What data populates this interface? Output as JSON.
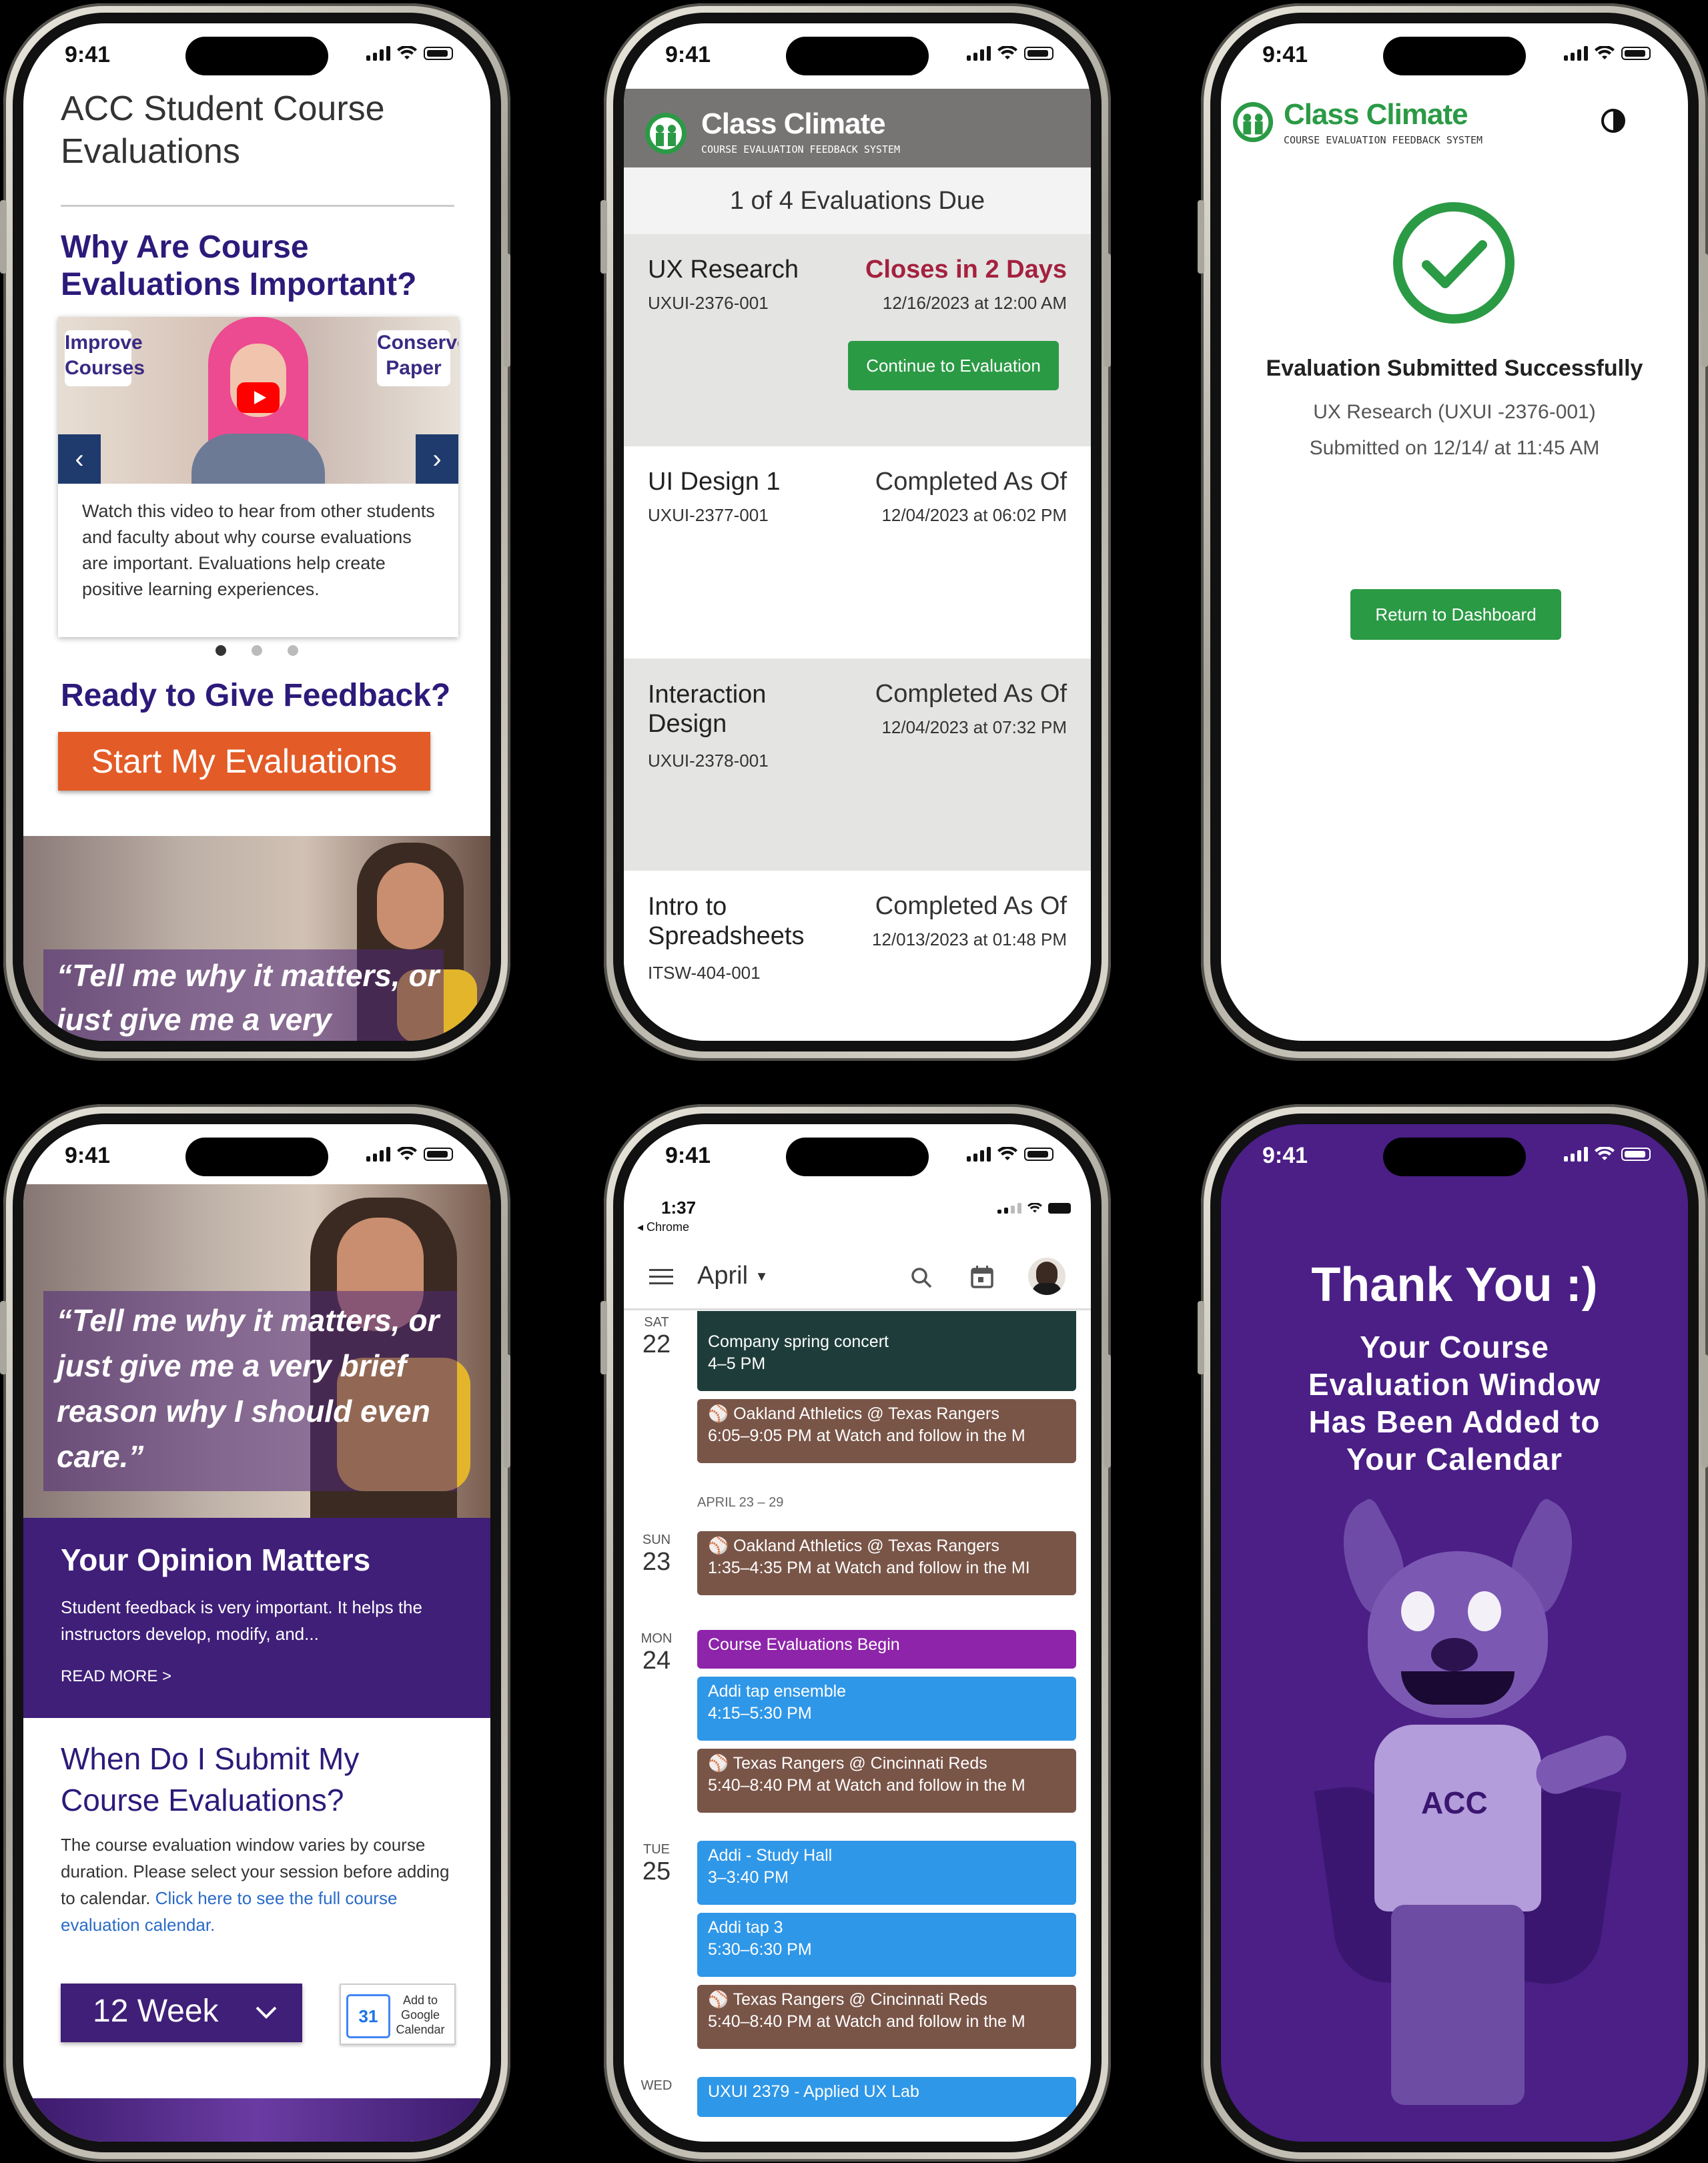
{
  "status_time": "9:41",
  "phone1": {
    "title": "ACC Student Course Evaluations",
    "section1_heading": "Why Are Course Evaluations Important?",
    "video_badge_left": "Improve Courses",
    "video_badge_right": "Conserve Paper",
    "video_caption": "Watch this video to hear from other students and faculty about why course evaluations are important. Evaluations help create positive learning experiences.",
    "section2_heading": "Ready to Give Feedback?",
    "cta_label": "Start My Evaluations",
    "quote_partial": "“Tell me why it matters, or just give me a very"
  },
  "phone2": {
    "logo_title": "Class Climate",
    "logo_subtitle": "COURSE EVALUATION FEEDBACK SYSTEM",
    "due_banner": "1 of 4 Evaluations Due",
    "evaluations": [
      {
        "course": "UX Research",
        "code": "UXUI-2376-001",
        "status": "Closes in 2 Days",
        "date": "12/16/2023 at 12:00 AM",
        "action": "Continue to Evaluation"
      },
      {
        "course": "UI Design 1",
        "code": "UXUI-2377-001",
        "status": "Completed As Of",
        "date": "12/04/2023 at 06:02 PM"
      },
      {
        "course": "Interaction Design",
        "code": "UXUI-2378-001",
        "status": "Completed As Of",
        "date": "12/04/2023 at 07:32 PM"
      },
      {
        "course": "Intro to Spreadsheets",
        "code": "ITSW-404-001",
        "status": "Completed As Of",
        "date": "12/013/2023 at 01:48 PM"
      }
    ],
    "colors": {
      "header": "#777574",
      "due": "#a4213f",
      "green": "#2b9a45"
    }
  },
  "phone3": {
    "logo_title": "Class Climate",
    "logo_subtitle": "COURSE EVALUATION FEEDBACK SYSTEM",
    "heading": "Evaluation Submitted Successfully",
    "course_line": "UX Research (UXUI -2376-001)",
    "submitted_line": "Submitted on 12/14/ at 11:45 AM",
    "return_label": "Return to Dashboard"
  },
  "phone4": {
    "quote": "“Tell me why it matters, or just give me a very brief reason why I should even care.”",
    "opinion_heading": "Your Opinion Matters",
    "opinion_text": "Student feedback is very important. It helps the instructors develop, modify, and...",
    "read_more": "READ MORE >",
    "submit_heading": "When Do I Submit My Course Evaluations?",
    "submit_text": "The course evaluation window varies by course duration. Please select your session before adding to calendar.",
    "submit_link": "Click here to see the full course evaluation calendar.",
    "select_value": "12 Week",
    "gcal_label": "Add to Google Calendar",
    "gcal_day": "31"
  },
  "phone5": {
    "inner_time": "1:37",
    "inner_back": "◂ Chrome",
    "month": "April",
    "week_label": "APRIL 23 – 29",
    "days": [
      {
        "name": "SAT",
        "num": "22"
      },
      {
        "name": "SUN",
        "num": "23"
      },
      {
        "name": "MON",
        "num": "24"
      },
      {
        "name": "TUE",
        "num": "25"
      },
      {
        "name": "WED",
        "num": ""
      }
    ],
    "events": [
      {
        "title": "Company spring concert",
        "time": "4–5 PM"
      },
      {
        "title": "Oakland Athletics @ Texas Rangers",
        "time": "6:05–9:05 PM at Watch and follow in the M"
      },
      {
        "title": "Oakland Athletics @ Texas Rangers",
        "time": "1:35–4:35 PM at Watch and follow in the MI"
      },
      {
        "title": "Course Evaluations Begin",
        "time": ""
      },
      {
        "title": "Addi tap ensemble",
        "time": "4:15–5:30 PM"
      },
      {
        "title": "Texas Rangers @ Cincinnati Reds",
        "time": "5:40–8:40 PM at Watch and follow in the M"
      },
      {
        "title": "Addi - Study Hall",
        "time": "3–3:40 PM"
      },
      {
        "title": "Addi tap 3",
        "time": "5:30–6:30 PM"
      },
      {
        "title": "Texas Rangers @ Cincinnati Reds",
        "time": "5:40–8:40 PM at Watch and follow in the M"
      },
      {
        "title": "UXUI 2379 - Applied UX Lab",
        "time": ""
      }
    ],
    "colors": {
      "brown": "#795548",
      "blue": "#2f97e8",
      "purple": "#8e24aa",
      "dark": "#1e3d3a"
    }
  },
  "phone6": {
    "heading": "Thank You :)",
    "subheading": "Your Course Evaluation Window Has Been Added to Your Calendar",
    "shirt_text": "ACC",
    "bg": "#4b1f86"
  }
}
